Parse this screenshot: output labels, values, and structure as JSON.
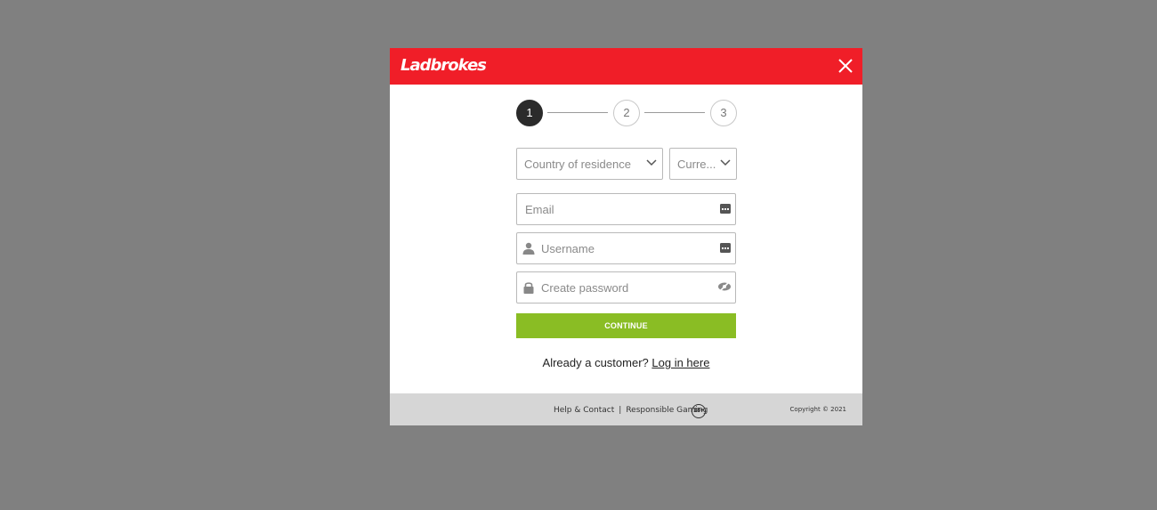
{
  "modal": {
    "brand": "Ladbrokes",
    "header_color": "#f01e28",
    "close_icon": "close-icon"
  },
  "stepper": {
    "steps": [
      {
        "label": "1",
        "state": "active"
      },
      {
        "label": "2",
        "state": "inactive"
      },
      {
        "label": "3",
        "state": "inactive"
      }
    ]
  },
  "form": {
    "country": {
      "placeholder": "Country of residence",
      "value": ""
    },
    "currency": {
      "placeholder": "Curre...",
      "value": ""
    },
    "email": {
      "placeholder": "Email",
      "value": ""
    },
    "username": {
      "placeholder": "Username",
      "value": ""
    },
    "password": {
      "placeholder": "Create password",
      "value": ""
    },
    "continue_label": "CONTINUE",
    "continue_color": "#8abd24"
  },
  "login_prompt": {
    "text": "Already a customer?",
    "link": "Log in here"
  },
  "footer": {
    "help": "Help & Contact",
    "separator": "|",
    "responsible": "Responsible Gaming",
    "age_badge": "18+",
    "copyright": "Copyright © 2021"
  }
}
